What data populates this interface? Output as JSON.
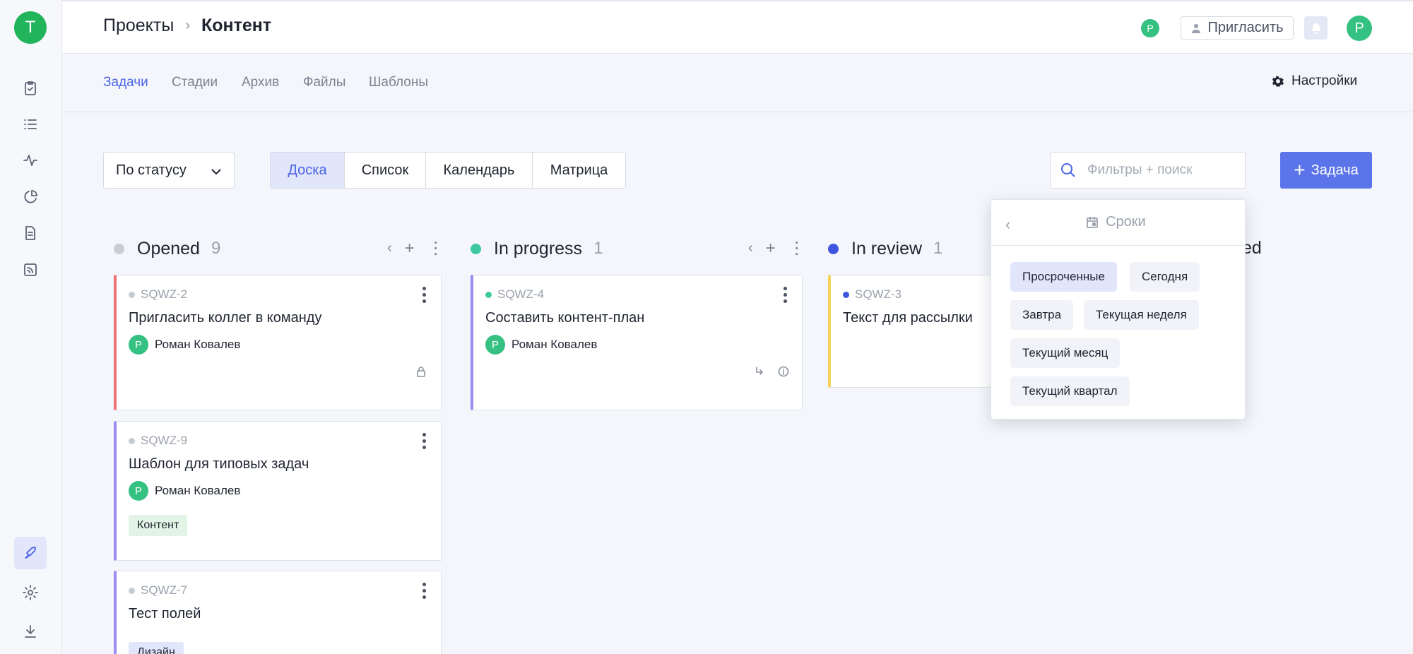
{
  "app": {
    "logo_letter": "T"
  },
  "header": {
    "breadcrumb_parent": "Проекты",
    "breadcrumb_separator": "›",
    "breadcrumb_current": "Контент",
    "mini_avatar": "Р",
    "invite_label": "Пригласить",
    "avatar": "Р"
  },
  "subnav": {
    "tabs": [
      "Задачи",
      "Стадии",
      "Архив",
      "Файлы",
      "Шаблоны"
    ],
    "active_tab": "Задачи",
    "settings_label": "Настройки"
  },
  "toolbar": {
    "group_by": "По статусу",
    "views": [
      "Доска",
      "Список",
      "Календарь",
      "Матрица"
    ],
    "active_view": "Доска",
    "search_placeholder": "Фильтры + поиск",
    "add_task_label": "Задача",
    "add_task_plus": "+"
  },
  "columns": [
    {
      "title": "Opened",
      "count": "9",
      "color": "#c8ccd4",
      "cards": [
        {
          "id": "SQWZ-2",
          "title": "Пригласить коллег в команду",
          "assignee": "Роман Ковалев",
          "assignee_initial": "Р",
          "accent": "#f07078",
          "dot": "#c8ccd4",
          "icons": [
            "lock-icon"
          ]
        },
        {
          "id": "SQWZ-9",
          "title": "Шаблон для типовых задач",
          "assignee": "Роман Ковалев",
          "assignee_initial": "Р",
          "accent": "#9b8cf2",
          "dot": "#c8ccd4",
          "tag": "Контент",
          "tag_color": "#e3f4e6"
        },
        {
          "id": "SQWZ-7",
          "title": "Тест полей",
          "accent": "#9b8cf2",
          "dot": "#c8ccd4",
          "tag": "Дизайн",
          "tag_color": "#e2e6fb"
        }
      ]
    },
    {
      "title": "In progress",
      "count": "1",
      "color": "#3ec9a0",
      "cards": [
        {
          "id": "SQWZ-4",
          "title": "Составить контент-план",
          "assignee": "Роман Ковалев",
          "assignee_initial": "Р",
          "accent": "#9b8cf2",
          "dot": "#3ec9a0",
          "icons": [
            "subtask-icon",
            "info-icon"
          ]
        }
      ]
    },
    {
      "title": "In review",
      "count": "1",
      "color": "#3f56e0",
      "cards": [
        {
          "id": "SQWZ-3",
          "title": "Текст для рассылки",
          "accent": "#f5d35a",
          "dot": "#3f56e0"
        }
      ]
    }
  ],
  "partial_column_title": "ed",
  "deadline_dropdown": {
    "back": "‹",
    "title": "Сроки",
    "options": [
      "Просроченные",
      "Сегодня",
      "Завтра",
      "Текущая неделя",
      "Текущий месяц",
      "Текущий квартал"
    ],
    "active_option": "Просроченные"
  }
}
